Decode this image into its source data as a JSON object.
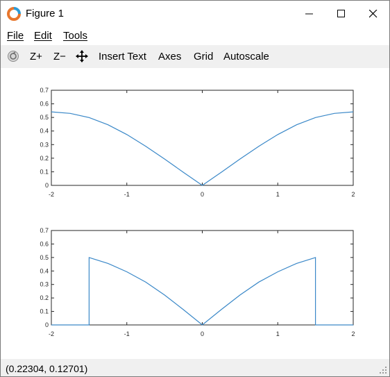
{
  "window": {
    "title": "Figure 1",
    "controls": [
      "minimize",
      "maximize",
      "close"
    ]
  },
  "menu": {
    "items": [
      {
        "label": "File",
        "underline": "F"
      },
      {
        "label": "Edit",
        "underline": "E"
      },
      {
        "label": "Tools",
        "underline": "T"
      }
    ]
  },
  "toolbar": {
    "zoom_in": "Z+",
    "zoom_out": "Z−",
    "insert_text": "Insert Text",
    "axes": "Axes",
    "grid": "Grid",
    "autoscale": "Autoscale"
  },
  "status": {
    "coordinates": "(0.22304, 0.12701)"
  },
  "colors": {
    "line": "#3a88c8",
    "toolbar_bg": "#f0f0f0"
  },
  "chart_data": [
    {
      "type": "line",
      "xlim": [
        -2,
        2
      ],
      "ylim": [
        0,
        0.7
      ],
      "x_ticks": [
        "-2",
        "-1",
        "0",
        "1",
        "2"
      ],
      "y_ticks": [
        "0",
        "0.1",
        "0.2",
        "0.3",
        "0.4",
        "0.5",
        "0.6",
        "0.7"
      ],
      "series": [
        {
          "x": [
            -2,
            -1.75,
            -1.5,
            -1.25,
            -1,
            -0.75,
            -0.5,
            -0.25,
            0,
            0.25,
            0.5,
            0.75,
            1,
            1.25,
            1.5,
            1.75,
            2
          ],
          "y": [
            0.541,
            0.53,
            0.499,
            0.446,
            0.374,
            0.288,
            0.194,
            0.096,
            0,
            0.096,
            0.194,
            0.288,
            0.374,
            0.446,
            0.499,
            0.53,
            0.541
          ]
        }
      ]
    },
    {
      "type": "line",
      "xlim": [
        -2,
        2
      ],
      "ylim": [
        0,
        0.7
      ],
      "x_ticks": [
        "-2",
        "-1",
        "0",
        "1",
        "2"
      ],
      "y_ticks": [
        "0",
        "0.1",
        "0.2",
        "0.3",
        "0.4",
        "0.5",
        "0.6",
        "0.7"
      ],
      "series": [
        {
          "x": [
            -2,
            -1.5,
            -1.5,
            -1.25,
            -1,
            -0.75,
            -0.5,
            -0.25,
            0,
            0.25,
            0.5,
            0.75,
            1,
            1.25,
            1.5,
            1.5,
            2
          ],
          "y": [
            0,
            0,
            0.5,
            0.456,
            0.394,
            0.318,
            0.222,
            0.113,
            0,
            0.113,
            0.222,
            0.318,
            0.394,
            0.456,
            0.5,
            0,
            0
          ]
        }
      ]
    }
  ]
}
